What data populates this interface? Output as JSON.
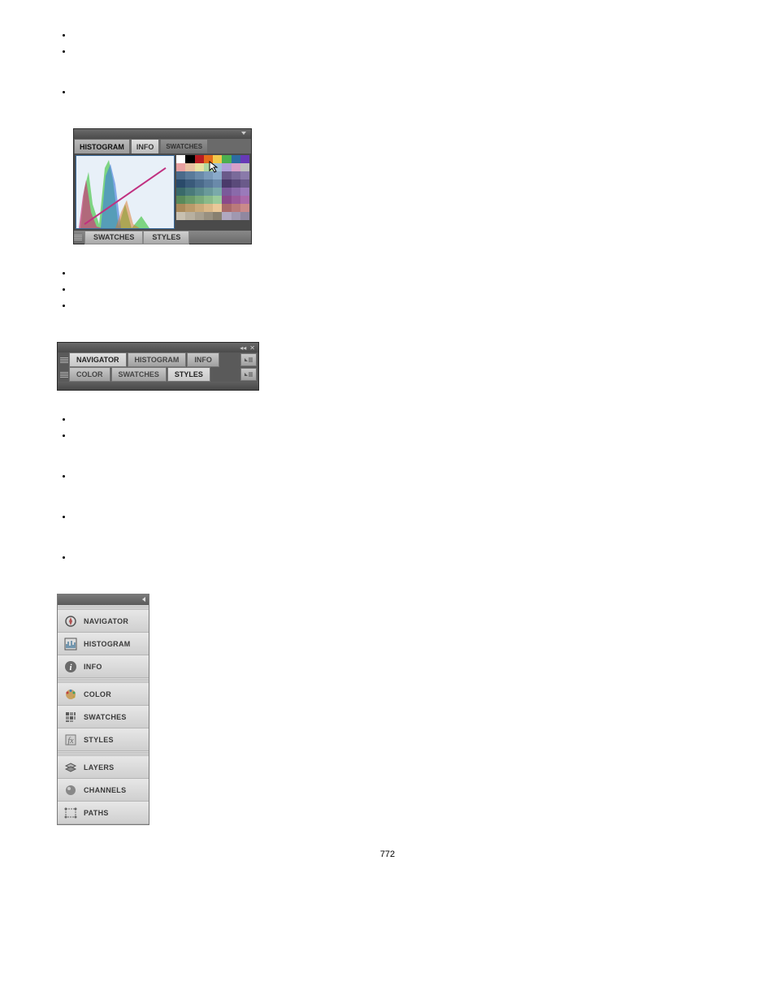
{
  "panel1": {
    "tabs": [
      "HISTOGRAM",
      "INFO",
      "SWATCHES"
    ],
    "bottom_tabs": [
      "SWATCHES",
      "STYLES"
    ],
    "swatch_colors": [
      "#ffffff",
      "#000000",
      "#b81c22",
      "#e46c1a",
      "#f2c94c",
      "#4caf50",
      "#2d6ca2",
      "#673ab7",
      "#e8a0a0",
      "#e8c0a0",
      "#e8e0a0",
      "#b0d8a0",
      "#a0c0d8",
      "#b0a0d8",
      "#d8a0c8",
      "#c0c0c0",
      "#4a6a8a",
      "#5a7a9a",
      "#6a8aaa",
      "#7a9aba",
      "#8aaaca",
      "#6a5a8a",
      "#7a6a9a",
      "#8a7aaa",
      "#2a4a6a",
      "#3a5a7a",
      "#4a6a8a",
      "#5a7a9a",
      "#6a8aaa",
      "#4a3a6a",
      "#5a4a7a",
      "#6a5a8a",
      "#3a6a6a",
      "#4a7a7a",
      "#5a8a8a",
      "#6a9a9a",
      "#7aaaaa",
      "#7a5a9a",
      "#8a6aaa",
      "#9a7aba",
      "#5a8a5a",
      "#6a9a6a",
      "#7aaa7a",
      "#8aba8a",
      "#9aca9a",
      "#8a4a8a",
      "#9a5a9a",
      "#aa6aaa",
      "#aa8a5a",
      "#ba9a6a",
      "#caaa7a",
      "#dab888",
      "#eac898",
      "#aa6a6a",
      "#ba7a7a",
      "#ca8a8a",
      "#c8c0b0",
      "#b8b0a0",
      "#a8a090",
      "#989080",
      "#888070",
      "#b0a8c0",
      "#a098b0",
      "#9088a0"
    ]
  },
  "panel2": {
    "row1": [
      "NAVIGATOR",
      "HISTOGRAM",
      "INFO"
    ],
    "row2": [
      "COLOR",
      "SWATCHES",
      "STYLES"
    ]
  },
  "panel3": {
    "groups": [
      [
        "NAVIGATOR",
        "HISTOGRAM",
        "INFO"
      ],
      [
        "COLOR",
        "SWATCHES",
        "STYLES"
      ],
      [
        "LAYERS",
        "CHANNELS",
        "PATHS"
      ]
    ]
  },
  "page_number": "772"
}
